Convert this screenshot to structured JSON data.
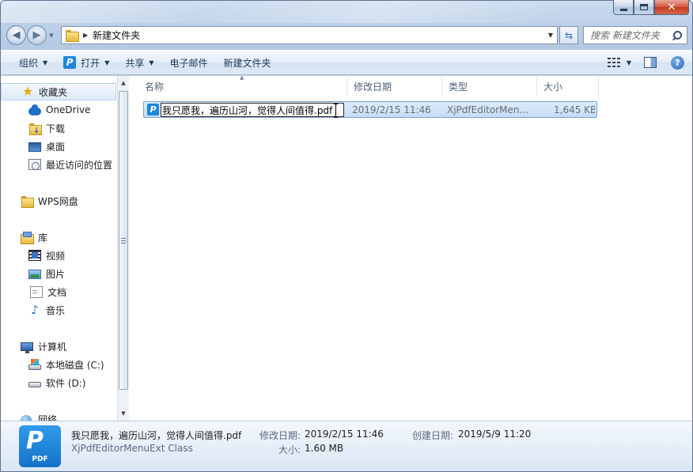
{
  "address": {
    "path": "新建文件夹"
  },
  "search": {
    "placeholder": "搜索 新建文件夹"
  },
  "toolbar": {
    "organize": "组织",
    "open": "打开",
    "share": "共享",
    "email": "电子邮件",
    "new_folder": "新建文件夹"
  },
  "nav": {
    "favorites": "收藏夹",
    "onedrive": "OneDrive",
    "downloads": "下载",
    "desktop": "桌面",
    "recent": "最近访问的位置",
    "wps": "WPS网盘",
    "libraries": "库",
    "videos": "视频",
    "pictures": "图片",
    "documents": "文档",
    "music": "音乐",
    "computer": "计算机",
    "drive_c": "本地磁盘 (C:)",
    "drive_d": "软件 (D:)",
    "network": "网络"
  },
  "columns": {
    "name": "名称",
    "modified": "修改日期",
    "type": "类型",
    "size": "大小"
  },
  "file": {
    "name": "我只愿我，遍历山河，觉得人间值得.pdf",
    "modified": "2019/2/15 11:46",
    "type": "XjPdfEditorMen...",
    "size": "1,645 KB"
  },
  "details": {
    "name": "我只愿我，遍历山河，觉得人间值得.pdf",
    "type": "XjPdfEditorMenuExt Class",
    "modified_label": "修改日期:",
    "modified_value": "2019/2/15 11:46",
    "created_label": "创建日期:",
    "created_value": "2019/5/9 11:20",
    "size_label": "大小:",
    "size_value": "1.60 MB",
    "icon_caption": "PDF"
  }
}
